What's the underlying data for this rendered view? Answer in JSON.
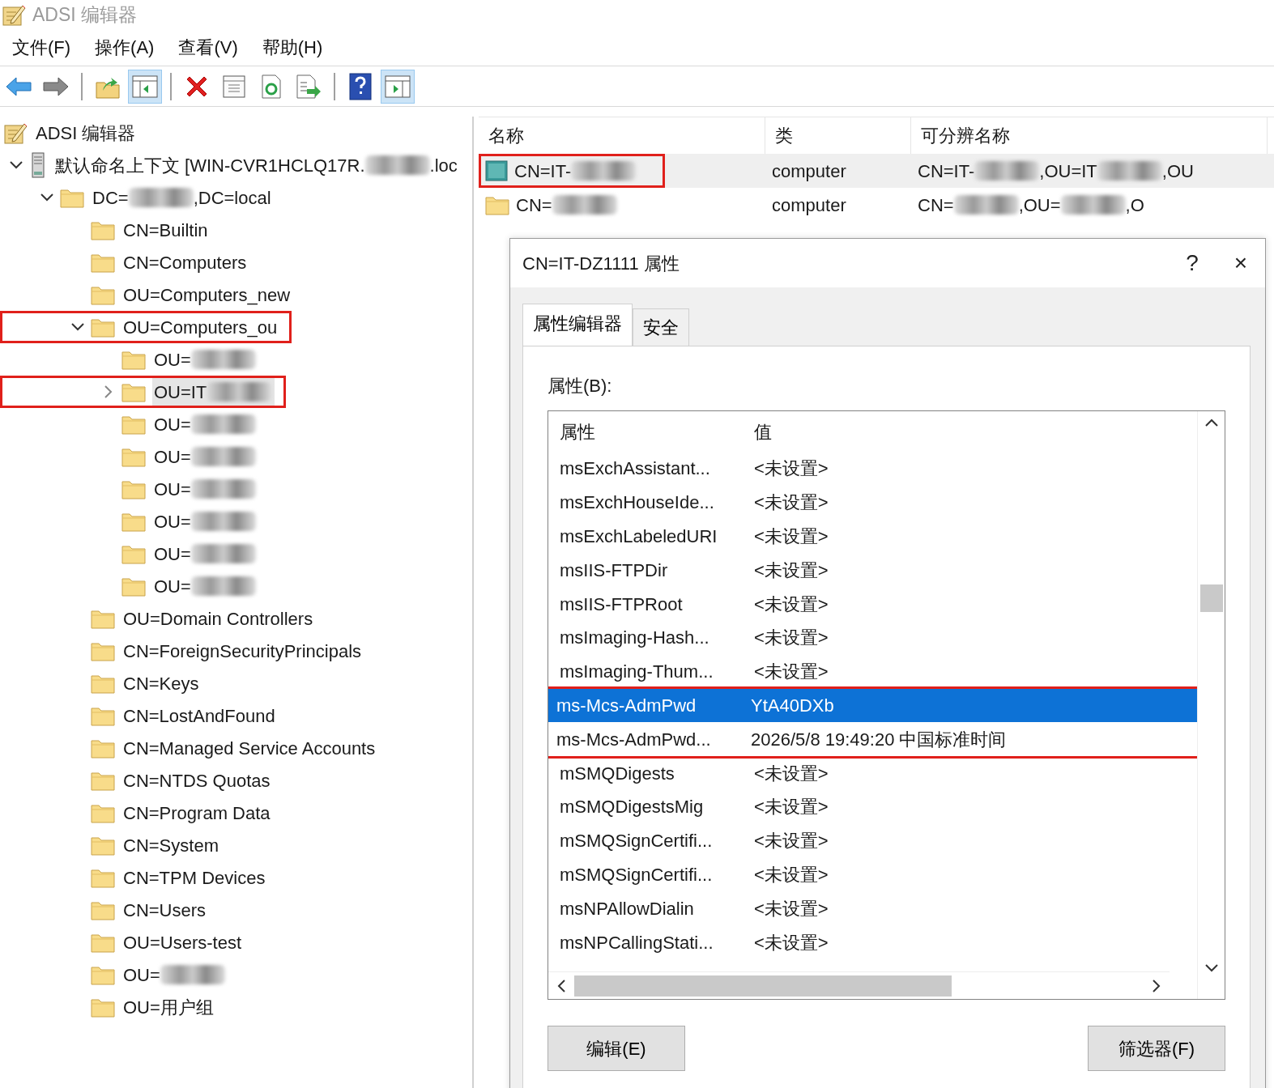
{
  "window": {
    "title": "ADSI 编辑器"
  },
  "menu": [
    {
      "label": "文件(F)"
    },
    {
      "label": "操作(A)"
    },
    {
      "label": "查看(V)"
    },
    {
      "label": "帮助(H)"
    }
  ],
  "toolbar": [
    {
      "kind": "back",
      "pressed": false
    },
    {
      "kind": "forward",
      "pressed": false
    },
    {
      "kind": "separator"
    },
    {
      "kind": "up",
      "pressed": false
    },
    {
      "kind": "panel-left",
      "pressed": true
    },
    {
      "kind": "separator"
    },
    {
      "kind": "delete",
      "pressed": false
    },
    {
      "kind": "properties",
      "pressed": false
    },
    {
      "kind": "refresh",
      "pressed": false
    },
    {
      "kind": "export",
      "pressed": false
    },
    {
      "kind": "separator"
    },
    {
      "kind": "help",
      "pressed": false
    },
    {
      "kind": "panel-right",
      "pressed": true
    }
  ],
  "tree": [
    {
      "kind": "adsi",
      "label": "ADSI 编辑器",
      "selected": false,
      "highlighted": false,
      "children": [
        {
          "kind": "server",
          "parts": [
            {
              "kind": "text",
              "text": "默认命名上下文 [WIN-CVR1HCLQ17R."
            },
            {
              "kind": "redacted"
            },
            {
              "kind": "text",
              "text": ".loc"
            }
          ],
          "expanded": true,
          "selected": false,
          "highlighted": false,
          "children": [
            {
              "kind": "folder",
              "parts": [
                {
                  "kind": "text",
                  "text": "DC="
                },
                {
                  "kind": "redacted"
                },
                {
                  "kind": "text",
                  "text": ",DC=local"
                }
              ],
              "expanded": true,
              "selected": false,
              "highlighted": false,
              "children": [
                {
                  "kind": "folder",
                  "label": "CN=Builtin",
                  "selected": false,
                  "highlighted": false
                },
                {
                  "kind": "folder",
                  "label": "CN=Computers",
                  "selected": false,
                  "highlighted": false
                },
                {
                  "kind": "folder",
                  "label": "OU=Computers_new",
                  "selected": false,
                  "highlighted": false
                },
                {
                  "kind": "folder",
                  "label": "OU=Computers_ou",
                  "expanded": true,
                  "selected": false,
                  "highlighted": true,
                  "children": [
                    {
                      "kind": "folder",
                      "parts": [
                        {
                          "kind": "text",
                          "text": "OU="
                        },
                        {
                          "kind": "redacted"
                        }
                      ],
                      "selected": false,
                      "highlighted": false
                    },
                    {
                      "kind": "folder",
                      "parts": [
                        {
                          "kind": "text",
                          "text": "OU=IT"
                        },
                        {
                          "kind": "redacted"
                        }
                      ],
                      "expanded": false,
                      "selected": true,
                      "highlighted": true
                    },
                    {
                      "kind": "folder",
                      "parts": [
                        {
                          "kind": "text",
                          "text": "OU="
                        },
                        {
                          "kind": "redacted"
                        }
                      ],
                      "selected": false,
                      "highlighted": false
                    },
                    {
                      "kind": "folder",
                      "parts": [
                        {
                          "kind": "text",
                          "text": "OU="
                        },
                        {
                          "kind": "redacted"
                        }
                      ],
                      "selected": false,
                      "highlighted": false
                    },
                    {
                      "kind": "folder",
                      "parts": [
                        {
                          "kind": "text",
                          "text": "OU="
                        },
                        {
                          "kind": "redacted"
                        }
                      ],
                      "selected": false,
                      "highlighted": false
                    },
                    {
                      "kind": "folder",
                      "parts": [
                        {
                          "kind": "text",
                          "text": "OU="
                        },
                        {
                          "kind": "redacted"
                        }
                      ],
                      "selected": false,
                      "highlighted": false
                    },
                    {
                      "kind": "folder",
                      "parts": [
                        {
                          "kind": "text",
                          "text": "OU="
                        },
                        {
                          "kind": "redacted"
                        }
                      ],
                      "selected": false,
                      "highlighted": false
                    },
                    {
                      "kind": "folder",
                      "parts": [
                        {
                          "kind": "text",
                          "text": "OU="
                        },
                        {
                          "kind": "redacted"
                        }
                      ],
                      "selected": false,
                      "highlighted": false
                    }
                  ]
                },
                {
                  "kind": "folder",
                  "label": "OU=Domain Controllers",
                  "selected": false,
                  "highlighted": false
                },
                {
                  "kind": "folder",
                  "label": "CN=ForeignSecurityPrincipals",
                  "selected": false,
                  "highlighted": false
                },
                {
                  "kind": "folder",
                  "label": "CN=Keys",
                  "selected": false,
                  "highlighted": false
                },
                {
                  "kind": "folder",
                  "label": "CN=LostAndFound",
                  "selected": false,
                  "highlighted": false
                },
                {
                  "kind": "folder",
                  "label": "CN=Managed Service Accounts",
                  "selected": false,
                  "highlighted": false
                },
                {
                  "kind": "folder",
                  "label": "CN=NTDS Quotas",
                  "selected": false,
                  "highlighted": false
                },
                {
                  "kind": "folder",
                  "label": "CN=Program Data",
                  "selected": false,
                  "highlighted": false
                },
                {
                  "kind": "folder",
                  "label": "CN=System",
                  "selected": false,
                  "highlighted": false
                },
                {
                  "kind": "folder",
                  "label": "CN=TPM Devices",
                  "selected": false,
                  "highlighted": false
                },
                {
                  "kind": "folder",
                  "label": "CN=Users",
                  "selected": false,
                  "highlighted": false
                },
                {
                  "kind": "folder",
                  "label": "OU=Users-test",
                  "selected": false,
                  "highlighted": false
                },
                {
                  "kind": "folder",
                  "parts": [
                    {
                      "kind": "text",
                      "text": "OU="
                    },
                    {
                      "kind": "redacted"
                    }
                  ],
                  "selected": false,
                  "highlighted": false
                },
                {
                  "kind": "folder",
                  "label": "OU=用户组",
                  "selected": false,
                  "highlighted": false
                }
              ]
            }
          ]
        }
      ]
    }
  ],
  "list": {
    "columns": [
      "名称",
      "类",
      "可分辨名称"
    ],
    "rows": [
      {
        "kind": "computer",
        "selected": true,
        "highlighted": true,
        "name": [
          {
            "kind": "text",
            "text": "CN=IT-"
          },
          {
            "kind": "redacted"
          }
        ],
        "class": "computer",
        "dn": [
          {
            "kind": "text",
            "text": "CN=IT-"
          },
          {
            "kind": "redacted"
          },
          {
            "kind": "text",
            "text": ",OU=IT"
          },
          {
            "kind": "redacted"
          },
          {
            "kind": "text",
            "text": ",OU"
          }
        ]
      },
      {
        "kind": "folder",
        "selected": false,
        "highlighted": false,
        "name": [
          {
            "kind": "text",
            "text": "CN="
          },
          {
            "kind": "redacted"
          }
        ],
        "class": "computer",
        "dn": [
          {
            "kind": "text",
            "text": "CN="
          },
          {
            "kind": "redacted"
          },
          {
            "kind": "text",
            "text": ",OU="
          },
          {
            "kind": "redacted"
          },
          {
            "kind": "text",
            "text": ",O"
          }
        ]
      }
    ]
  },
  "dialog": {
    "title": "CN=IT-DZ1111 属性",
    "help": "?",
    "close": "×",
    "tabs": [
      {
        "label": "属性编辑器",
        "selected": true
      },
      {
        "label": "安全",
        "selected": false
      }
    ],
    "attributes_label": "属性(B):",
    "columns": [
      "属性",
      "值"
    ],
    "rows": [
      {
        "name": "msExchAssistant...",
        "value": "<未设置>",
        "selected": false,
        "highlighted": false
      },
      {
        "name": "msExchHouseIde...",
        "value": "<未设置>",
        "selected": false,
        "highlighted": false
      },
      {
        "name": "msExchLabeledURI",
        "value": "<未设置>",
        "selected": false,
        "highlighted": false
      },
      {
        "name": "msIIS-FTPDir",
        "value": "<未设置>",
        "selected": false,
        "highlighted": false
      },
      {
        "name": "msIIS-FTPRoot",
        "value": "<未设置>",
        "selected": false,
        "highlighted": false
      },
      {
        "name": "msImaging-Hash...",
        "value": "<未设置>",
        "selected": false,
        "highlighted": false
      },
      {
        "name": "msImaging-Thum...",
        "value": "<未设置>",
        "selected": false,
        "highlighted": false
      },
      {
        "name": "ms-Mcs-AdmPwd",
        "value": "YtA40DXb",
        "selected": true,
        "highlighted": true
      },
      {
        "name": "ms-Mcs-AdmPwd...",
        "value": "2026/5/8 19:49:20 中国标准时间",
        "selected": false,
        "highlighted": true
      },
      {
        "name": "mSMQDigests",
        "value": "<未设置>",
        "selected": false,
        "highlighted": false
      },
      {
        "name": "mSMQDigestsMig",
        "value": "<未设置>",
        "selected": false,
        "highlighted": false
      },
      {
        "name": "mSMQSignCertifi...",
        "value": "<未设置>",
        "selected": false,
        "highlighted": false
      },
      {
        "name": "mSMQSignCertifi...",
        "value": "<未设置>",
        "selected": false,
        "highlighted": false
      },
      {
        "name": "msNPAllowDialin",
        "value": "<未设置>",
        "selected": false,
        "highlighted": false
      },
      {
        "name": "msNPCallingStati...",
        "value": "<未设置>",
        "selected": false,
        "highlighted": false
      }
    ],
    "buttons": [
      {
        "label": "编辑(E)"
      },
      {
        "label": "筛选器(F)"
      }
    ]
  }
}
